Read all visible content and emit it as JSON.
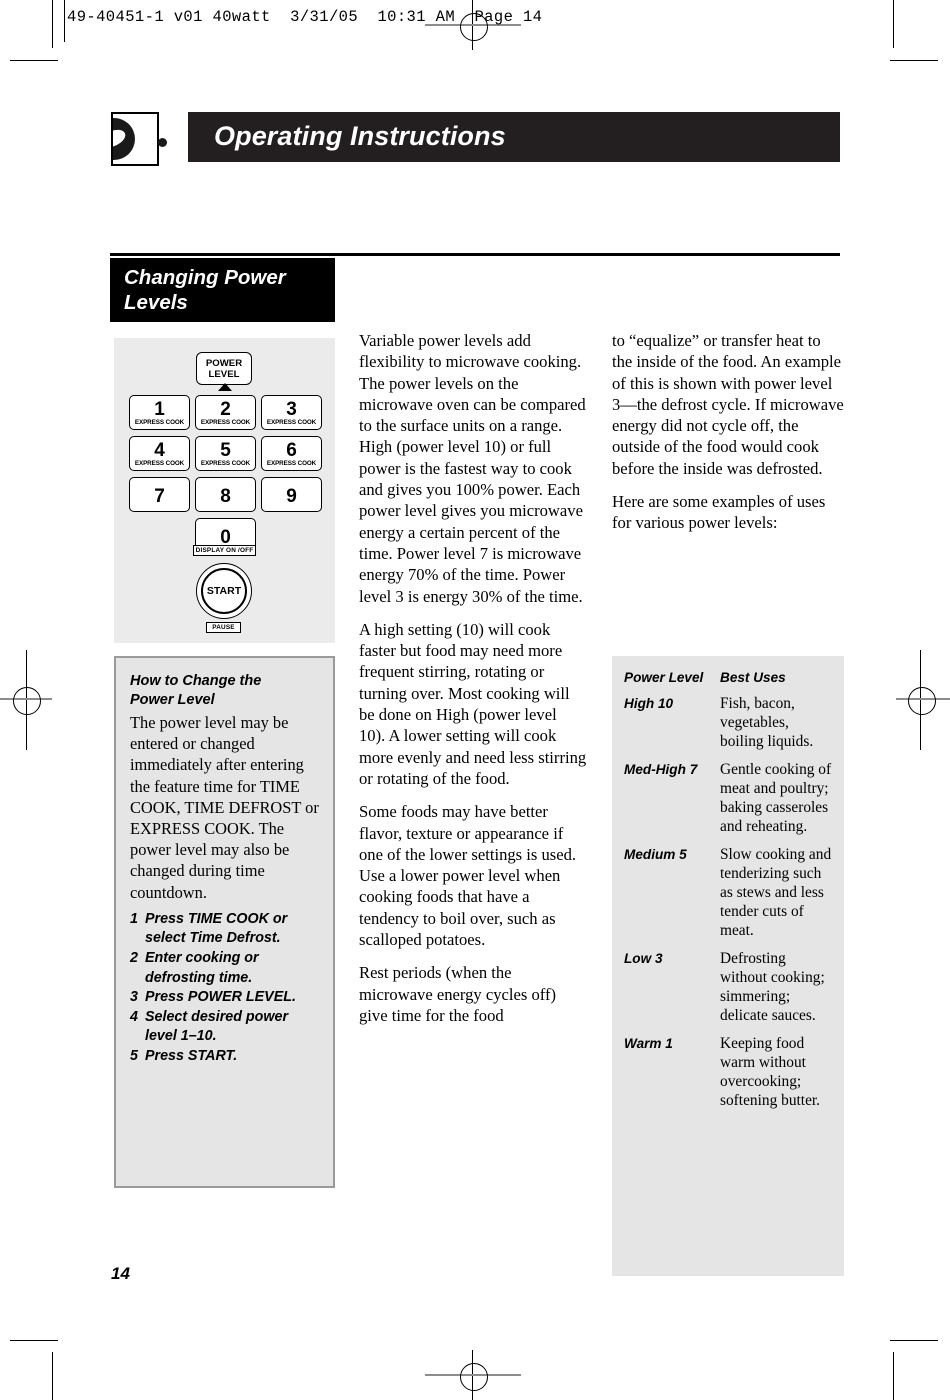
{
  "print_header": {
    "text": "49-40451-1 v01 40watt  3/31/05  10:31 AM  Page 14"
  },
  "titlebar": {
    "title": "Operating Instructions"
  },
  "section": {
    "heading_line1": "Changing Power",
    "heading_line2": "Levels"
  },
  "keypad": {
    "power_level_line1": "POWER",
    "power_level_line2": "LEVEL",
    "keys": [
      {
        "num": "1",
        "sub": "EXPRESS COOK"
      },
      {
        "num": "2",
        "sub": "EXPRESS COOK"
      },
      {
        "num": "3",
        "sub": "EXPRESS COOK"
      },
      {
        "num": "4",
        "sub": "EXPRESS COOK"
      },
      {
        "num": "5",
        "sub": "EXPRESS COOK"
      },
      {
        "num": "6",
        "sub": "EXPRESS COOK"
      },
      {
        "num": "7",
        "sub": ""
      },
      {
        "num": "8",
        "sub": ""
      },
      {
        "num": "9",
        "sub": ""
      },
      {
        "num": "0",
        "sub": ""
      }
    ],
    "display_label": "DISPLAY ON /OFF",
    "start_label": "START",
    "pause_label": "PAUSE"
  },
  "howto": {
    "title_line1": "How to Change the",
    "title_line2": "Power Level",
    "body": "The power level may be entered or changed immediately after entering the feature time for TIME COOK, TIME DEFROST or EXPRESS COOK. The power level may also be changed during time countdown.",
    "steps": [
      {
        "num": "1",
        "text": "Press TIME COOK or select Time Defrost."
      },
      {
        "num": "2",
        "text": "Enter cooking or defrosting time."
      },
      {
        "num": "3",
        "text": "Press POWER LEVEL."
      },
      {
        "num": "4",
        "text": "Select desired power level 1–10."
      },
      {
        "num": "5",
        "text": "Press START."
      }
    ]
  },
  "column_middle": {
    "p1": "Variable power levels add flexibility to microwave cooking. The power levels on the microwave oven can be compared to the surface units on a range. High (power level 10) or full power is the fastest way to cook and gives you 100% power. Each power level gives you microwave energy a certain percent of the time. Power level 7 is microwave energy 70% of the time. Power level 3 is energy 30% of the time.",
    "p2": "A high setting (10) will cook faster but food may need more frequent stirring, rotating or turning over. Most cooking will be done on High (power level 10). A lower setting will cook more evenly and need less stirring or rotating of the food.",
    "p3": "Some foods may have better flavor, texture or appearance if one of the lower settings is used. Use a lower power level when cooking foods that have a tendency to boil over, such as scalloped potatoes.",
    "p4": "Rest periods (when the microwave energy cycles off) give time for the food"
  },
  "column_right": {
    "p1": "to “equalize” or transfer heat to the inside of the food. An example of this is shown with power level 3—the defrost cycle. If microwave energy did not cycle off, the outside of the food would cook before the inside was defrosted.",
    "p2": "Here are some examples of uses for various power levels:"
  },
  "power_table": {
    "header": {
      "level": "Power Level",
      "use": "Best Uses"
    },
    "rows": [
      {
        "level": "High 10",
        "use": "Fish, bacon, vegetables, boiling liquids."
      },
      {
        "level": "Med-High 7",
        "use": "Gentle cooking of meat and poultry; baking casseroles and reheating."
      },
      {
        "level": "Medium 5",
        "use": "Slow cooking and tenderizing such as stews and less tender cuts of meat."
      },
      {
        "level": "Low 3",
        "use": "Defrosting without cooking; simmering; delicate sauces."
      },
      {
        "level": "Warm 1",
        "use": "Keeping food warm without overcooking; softening butter."
      }
    ]
  },
  "footer": {
    "page_number": "14"
  },
  "colors": {
    "title_bar": "#231f20",
    "panel_gray": "#ebebeb",
    "box_gray": "#e5e5e5",
    "box_border": "#9a9a9a"
  }
}
